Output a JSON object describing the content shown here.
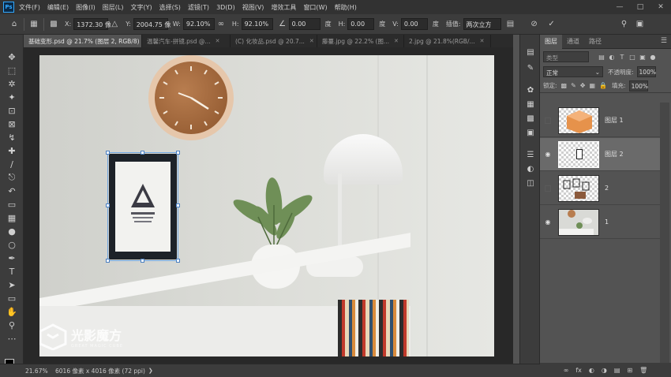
{
  "menu": {
    "logo": "Ps",
    "items": [
      "文件(F)",
      "编辑(E)",
      "图像(I)",
      "图层(L)",
      "文字(Y)",
      "选择(S)",
      "滤镜(T)",
      "3D(D)",
      "视图(V)",
      "增效工具",
      "窗口(W)",
      "帮助(H)"
    ]
  },
  "options": {
    "x_label": "X:",
    "x_value": "1372.30 像",
    "y_label": "Y:",
    "y_value": "2004.75 像",
    "w_label": "W:",
    "w_value": "92.10%",
    "h_label": "H:",
    "h_value": "92.10%",
    "angle_value": "0.00",
    "angle_unit": "度",
    "skew_h_label": "H:",
    "skew_h_value": "0.00",
    "skew_h_unit": "度",
    "skew_v_label": "V:",
    "skew_v_value": "0.00",
    "skew_v_unit": "度",
    "interp_label": "插值:",
    "interp_value": "两次立方"
  },
  "tabs": [
    {
      "label": "基础变形.psd @ 21.7% (图层 2, RGB/8) *"
    },
    {
      "label": "温馨汽车-拼镜.psd @..."
    },
    {
      "label": "(C) 化妆品.psd @ 20.7..."
    },
    {
      "label": "藤蔓.jpg @ 22.2% (图..."
    },
    {
      "label": "2.jpg @ 21.8%(RGB/..."
    }
  ],
  "status": {
    "zoom": "21.67%",
    "info": "6016 像素 x 4016 像素 (72 ppi)"
  },
  "watermark": {
    "brand": "光影魔方",
    "sub": "GREAT MAGIC CUBE"
  },
  "layers_panel": {
    "tabs": [
      "图层",
      "通道",
      "路径"
    ],
    "filter_placeholder": "类型",
    "blend_mode": "正常",
    "opacity_label": "不透明度:",
    "opacity_value": "100%",
    "lock_label": "锁定:",
    "fill_label": "填充:",
    "fill_value": "100%",
    "layers": [
      {
        "name": "图层 1",
        "visible": false,
        "selected": false
      },
      {
        "name": "图层 2",
        "visible": true,
        "selected": true
      },
      {
        "name": "2",
        "visible": false,
        "selected": false
      },
      {
        "name": "1",
        "visible": true,
        "selected": false
      }
    ]
  }
}
